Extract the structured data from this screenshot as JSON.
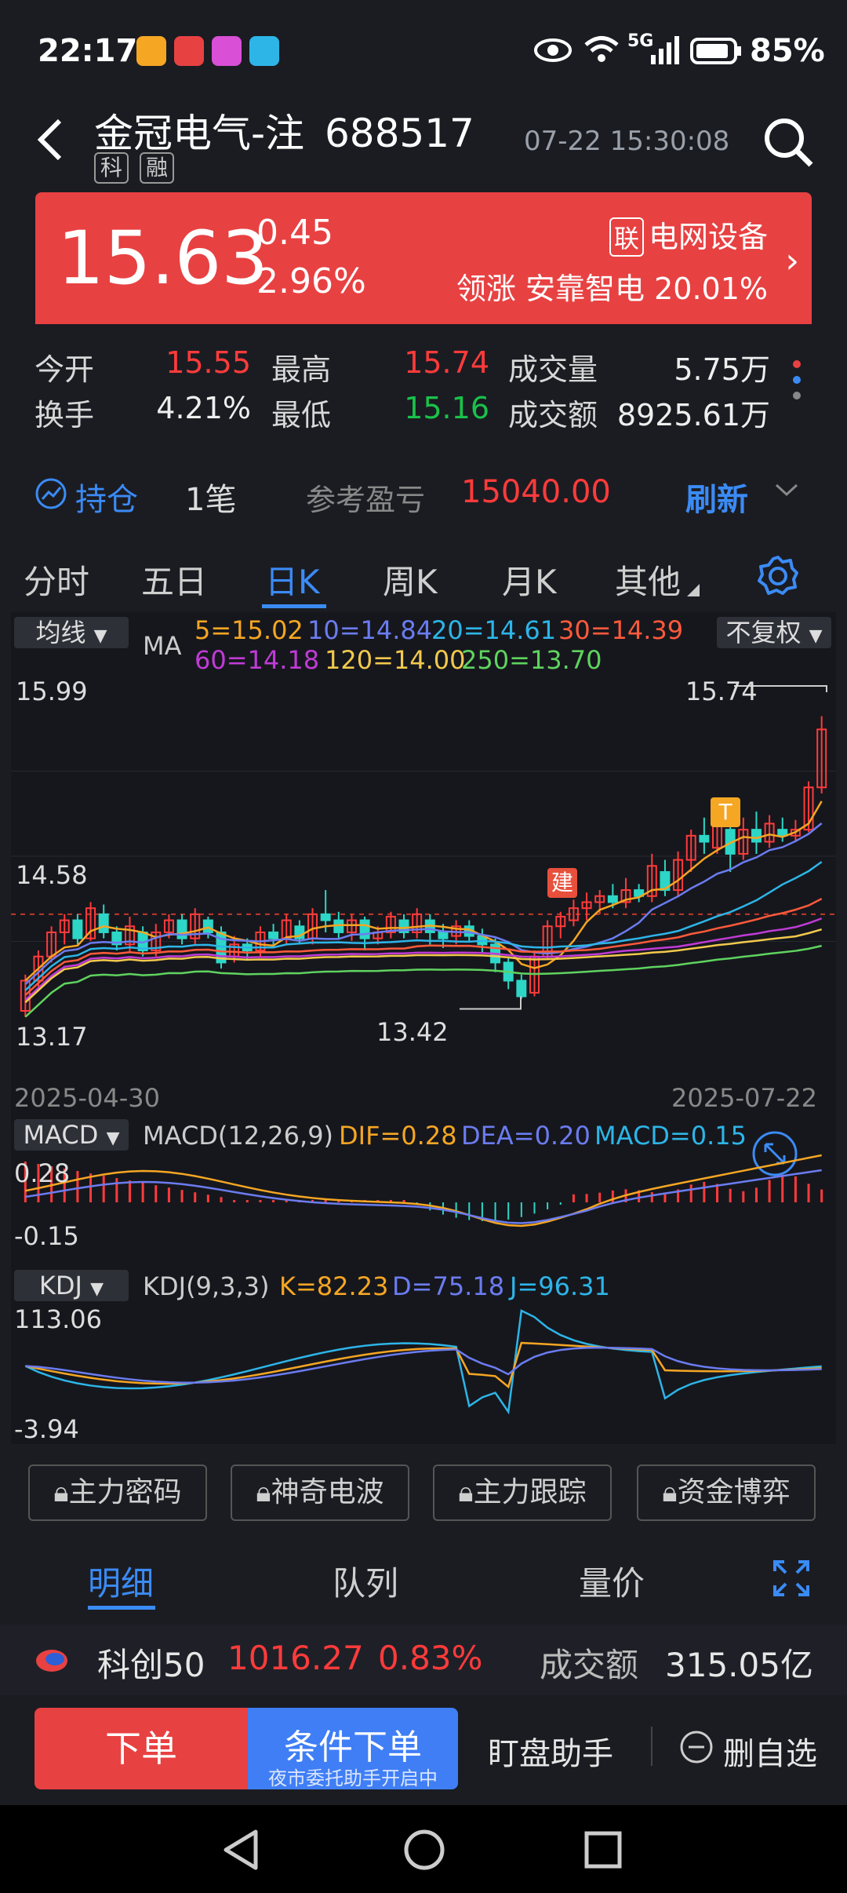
{
  "status": {
    "time": "22:17",
    "network": "5G",
    "battery": "85%"
  },
  "header": {
    "name": "金冠电气-注",
    "code": "688517",
    "tags": [
      "科",
      "融"
    ],
    "datetime": "07-22 15:30:08"
  },
  "quote": {
    "price": "15.63",
    "change": "0.45",
    "percent": "2.96%",
    "sector_badge": "联",
    "sector": "电网设备",
    "leader_label": "领涨",
    "leader_name": "安靠智电",
    "leader_pct": "20.01%"
  },
  "stats": {
    "open_label": "今开",
    "open": "15.55",
    "high_label": "最高",
    "high": "15.74",
    "vol_label": "成交量",
    "vol": "5.75万",
    "turn_label": "换手",
    "turn": "4.21%",
    "low_label": "最低",
    "low": "15.16",
    "amt_label": "成交额",
    "amt": "8925.61万"
  },
  "position": {
    "label": "持仓",
    "count": "1笔",
    "pnl_label": "参考盈亏",
    "pnl": "15040.00",
    "refresh": "刷新"
  },
  "tabs": [
    "分时",
    "五日",
    "日K",
    "周K",
    "月K",
    "其他"
  ],
  "active_tab": "日K",
  "kchart": {
    "select": "均线",
    "ma_label": "MA",
    "adjust": "不复权",
    "ma5": "5=15.02",
    "ma10": "10=14.84",
    "ma20": "20=14.61",
    "ma30": "30=14.39",
    "ma60": "60=14.18",
    "ma120": "120=14.00",
    "ma250": "250=13.70",
    "y_top": "15.99",
    "y_mid": "14.58",
    "y_bottom": "13.17",
    "max_label": "15.74",
    "min_label": "13.42",
    "date_start": "2025-04-30",
    "date_end": "2025-07-22",
    "mark_build": "建",
    "mark_t": "T"
  },
  "macd": {
    "select": "MACD",
    "params": "MACD(12,26,9)",
    "dif": "DIF=0.28",
    "dea": "DEA=0.20",
    "macd": "MACD=0.15",
    "y_top": "0.28",
    "y_bottom": "-0.15"
  },
  "kdj": {
    "select": "KDJ",
    "params": "KDJ(9,3,3)",
    "k": "K=82.23",
    "d": "D=75.18",
    "j": "J=96.31",
    "y_top": "113.06",
    "y_bottom": "-3.94"
  },
  "features": [
    "主力密码",
    "神奇电波",
    "主力跟踪",
    "资金博弈"
  ],
  "detail_tabs": [
    "明细",
    "队列",
    "量价"
  ],
  "index": {
    "name": "科创50",
    "value": "1016.27",
    "pct": "0.83%",
    "amt_label": "成交额",
    "amt": "315.05亿"
  },
  "orders": {
    "buy": "下单",
    "cond": "条件下单",
    "cond_sub": "夜市委托助手开启中",
    "assist": "盯盘助手",
    "remove": "删自选"
  },
  "chart_data": {
    "type": "candlestick",
    "ylim": [
      13.17,
      15.99
    ],
    "candles": [
      [
        13.3,
        13.55,
        13.25,
        13.6
      ],
      [
        13.55,
        13.75,
        13.5,
        13.8
      ],
      [
        13.75,
        13.95,
        13.7,
        14.0
      ],
      [
        13.95,
        14.05,
        13.85,
        14.1
      ],
      [
        14.05,
        13.9,
        13.85,
        14.1
      ],
      [
        13.9,
        14.15,
        13.88,
        14.2
      ],
      [
        14.1,
        13.95,
        13.9,
        14.18
      ],
      [
        13.95,
        13.85,
        13.8,
        14.0
      ],
      [
        13.85,
        14.0,
        13.78,
        14.08
      ],
      [
        13.95,
        13.8,
        13.75,
        14.0
      ],
      [
        13.8,
        13.95,
        13.75,
        14.02
      ],
      [
        13.95,
        14.05,
        13.9,
        14.1
      ],
      [
        14.05,
        13.9,
        13.85,
        14.1
      ],
      [
        13.9,
        14.1,
        13.85,
        14.15
      ],
      [
        14.05,
        13.95,
        13.9,
        14.08
      ],
      [
        13.95,
        13.7,
        13.65,
        14.0
      ],
      [
        13.75,
        13.85,
        13.7,
        13.92
      ],
      [
        13.85,
        13.8,
        13.72,
        13.9
      ],
      [
        13.8,
        13.95,
        13.75,
        14.0
      ],
      [
        13.95,
        13.9,
        13.82,
        14.02
      ],
      [
        13.9,
        14.05,
        13.85,
        14.1
      ],
      [
        14.0,
        13.9,
        13.85,
        14.05
      ],
      [
        13.9,
        14.1,
        13.85,
        14.15
      ],
      [
        14.1,
        14.05,
        13.95,
        14.3
      ],
      [
        14.05,
        13.95,
        13.9,
        14.12
      ],
      [
        13.95,
        14.05,
        13.88,
        14.1
      ],
      [
        14.05,
        13.9,
        13.8,
        14.08
      ],
      [
        13.9,
        13.95,
        13.85,
        14.0
      ],
      [
        13.95,
        14.08,
        13.9,
        14.12
      ],
      [
        14.05,
        13.95,
        13.9,
        14.1
      ],
      [
        13.95,
        14.1,
        13.9,
        14.15
      ],
      [
        14.05,
        13.95,
        13.85,
        14.1
      ],
      [
        13.95,
        13.9,
        13.82,
        14.02
      ],
      [
        13.92,
        14.0,
        13.85,
        14.05
      ],
      [
        14.0,
        13.92,
        13.88,
        14.05
      ],
      [
        13.92,
        13.85,
        13.78,
        13.98
      ],
      [
        13.85,
        13.7,
        13.62,
        13.9
      ],
      [
        13.7,
        13.55,
        13.48,
        13.75
      ],
      [
        13.55,
        13.42,
        13.4,
        13.6
      ],
      [
        13.45,
        13.75,
        13.42,
        13.8
      ],
      [
        13.75,
        14.0,
        13.72,
        14.05
      ],
      [
        14.0,
        14.08,
        13.9,
        14.12
      ],
      [
        14.05,
        14.15,
        14.0,
        14.22
      ],
      [
        14.15,
        14.2,
        14.05,
        14.28
      ],
      [
        14.2,
        14.25,
        14.1,
        14.3
      ],
      [
        14.25,
        14.2,
        14.15,
        14.35
      ],
      [
        14.2,
        14.3,
        14.15,
        14.4
      ],
      [
        14.3,
        14.25,
        14.2,
        14.35
      ],
      [
        14.25,
        14.5,
        14.2,
        14.6
      ],
      [
        14.45,
        14.3,
        14.25,
        14.55
      ],
      [
        14.3,
        14.55,
        14.25,
        14.62
      ],
      [
        14.55,
        14.75,
        14.45,
        14.8
      ],
      [
        14.75,
        14.7,
        14.6,
        14.9
      ],
      [
        14.65,
        14.85,
        14.6,
        15.0
      ],
      [
        14.8,
        14.6,
        14.45,
        14.85
      ],
      [
        14.6,
        14.8,
        14.55,
        14.9
      ],
      [
        14.8,
        14.7,
        14.6,
        14.95
      ],
      [
        14.7,
        14.85,
        14.65,
        14.92
      ],
      [
        14.8,
        14.75,
        14.7,
        14.9
      ],
      [
        14.75,
        14.8,
        14.7,
        14.88
      ],
      [
        14.8,
        15.15,
        14.78,
        15.2
      ],
      [
        15.15,
        15.63,
        15.1,
        15.74
      ]
    ],
    "ma5": "15.02",
    "ma10": "14.84",
    "ma20": "14.61",
    "ma30": "14.39",
    "ma60": "14.18",
    "ma120": "14.00",
    "ma250": "13.70"
  }
}
